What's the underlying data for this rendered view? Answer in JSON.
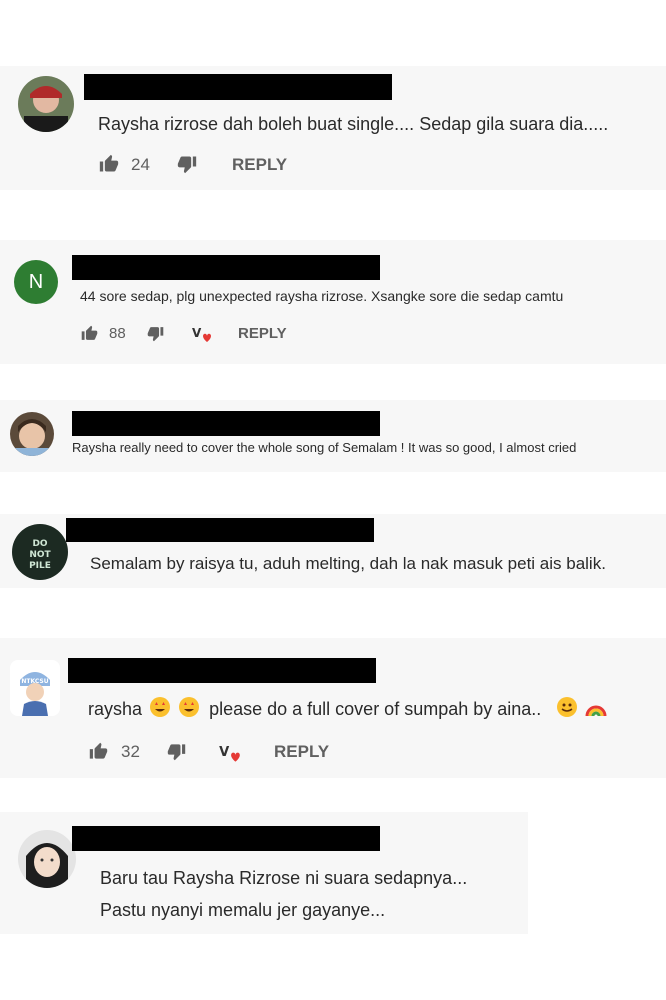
{
  "comments": [
    {
      "text": "Raysha rizrose dah boleh buat single.... Sedap gila suara dia.....",
      "likes": "24",
      "reply": "REPLY"
    },
    {
      "avatar_letter": "N",
      "text": "44 sore sedap, plg unexpected raysha rizrose. Xsangke sore die sedap camtu",
      "likes": "88",
      "reply": "REPLY"
    },
    {
      "text": "Raysha really need to cover the whole song of Semalam ! It was so good, I almost cried"
    },
    {
      "avatar_text": "DO NOT PILE",
      "text": "Semalam by raisya tu, aduh melting, dah la nak masuk peti ais balik."
    },
    {
      "avatar_text": "NTKCSU",
      "text_pre": "raysha",
      "text_post": "please do a full cover of sumpah by aina..",
      "likes": "32",
      "reply": "REPLY"
    },
    {
      "text_line1": "Baru tau Raysha Rizrose ni suara sedapnya...",
      "text_line2": "Pastu nyanyi memalu jer gayanye..."
    }
  ],
  "icons": [
    "thumbs-up-icon",
    "thumbs-down-icon",
    "creator-heart-icon",
    "star-struck-emoji",
    "smiling-face-emoji",
    "rainbow-emoji"
  ],
  "colors": {
    "card_bg": "#f7f7f7",
    "redaction": "#000000",
    "avatar_N": "#2e7d32",
    "heart": "#e53935",
    "action_text": "#606060"
  }
}
